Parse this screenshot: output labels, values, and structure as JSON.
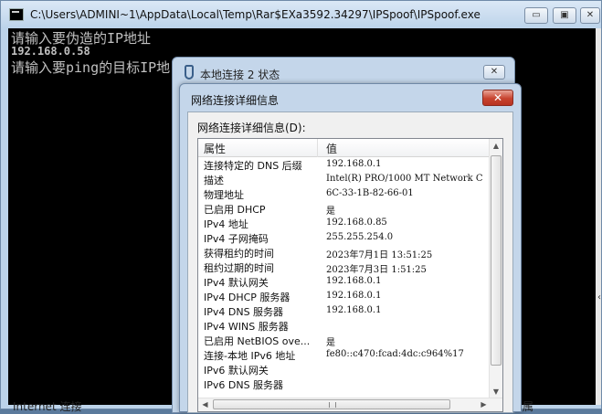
{
  "console": {
    "title": "C:\\Users\\ADMINI~1\\AppData\\Local\\Temp\\Rar$EXa3592.34297\\IPSpoof\\IPSpoof.exe",
    "minimize": "▭",
    "restore": "▣",
    "close": "✕",
    "lines": [
      "请输入要伪造的IP地址",
      "192.168.0.58",
      "请输入要ping的目标IP地"
    ]
  },
  "status_dialog": {
    "title": "本地连接 2 状态",
    "close": "✕"
  },
  "details_dialog": {
    "title": "网络连接详细信息",
    "close": "✕",
    "label": "网络连接详细信息(D):",
    "header": {
      "prop": "属性",
      "val": "值"
    },
    "rows": [
      {
        "prop": "连接特定的 DNS 后缀",
        "val": "192.168.0.1"
      },
      {
        "prop": "描述",
        "val": "Intel(R) PRO/1000 MT Network C"
      },
      {
        "prop": "物理地址",
        "val": "6C-33-1B-82-66-01"
      },
      {
        "prop": "已启用 DHCP",
        "val": "是"
      },
      {
        "prop": "IPv4 地址",
        "val": "192.168.0.85"
      },
      {
        "prop": "IPv4 子网掩码",
        "val": "255.255.254.0"
      },
      {
        "prop": "获得租约的时间",
        "val": "2023年7月1日 13:51:25"
      },
      {
        "prop": "租约过期的时间",
        "val": "2023年7月3日 1:51:25"
      },
      {
        "prop": "IPv4 默认网关",
        "val": "192.168.0.1"
      },
      {
        "prop": "IPv4 DHCP 服务器",
        "val": "192.168.0.1"
      },
      {
        "prop": "IPv4 DNS 服务器",
        "val": "192.168.0.1"
      },
      {
        "prop": "IPv4 WINS 服务器",
        "val": ""
      },
      {
        "prop": "已启用 NetBIOS ove...",
        "val": "是"
      },
      {
        "prop": "连接-本地 IPv6 地址",
        "val": "fe80::c470:fcad:4dc:c964%17"
      },
      {
        "prop": "IPv6 默认网关",
        "val": ""
      },
      {
        "prop": "IPv6 DNS 服务器",
        "val": ""
      }
    ]
  },
  "background": {
    "bottom_left": "Internet 连接",
    "bottom_right": "属"
  }
}
